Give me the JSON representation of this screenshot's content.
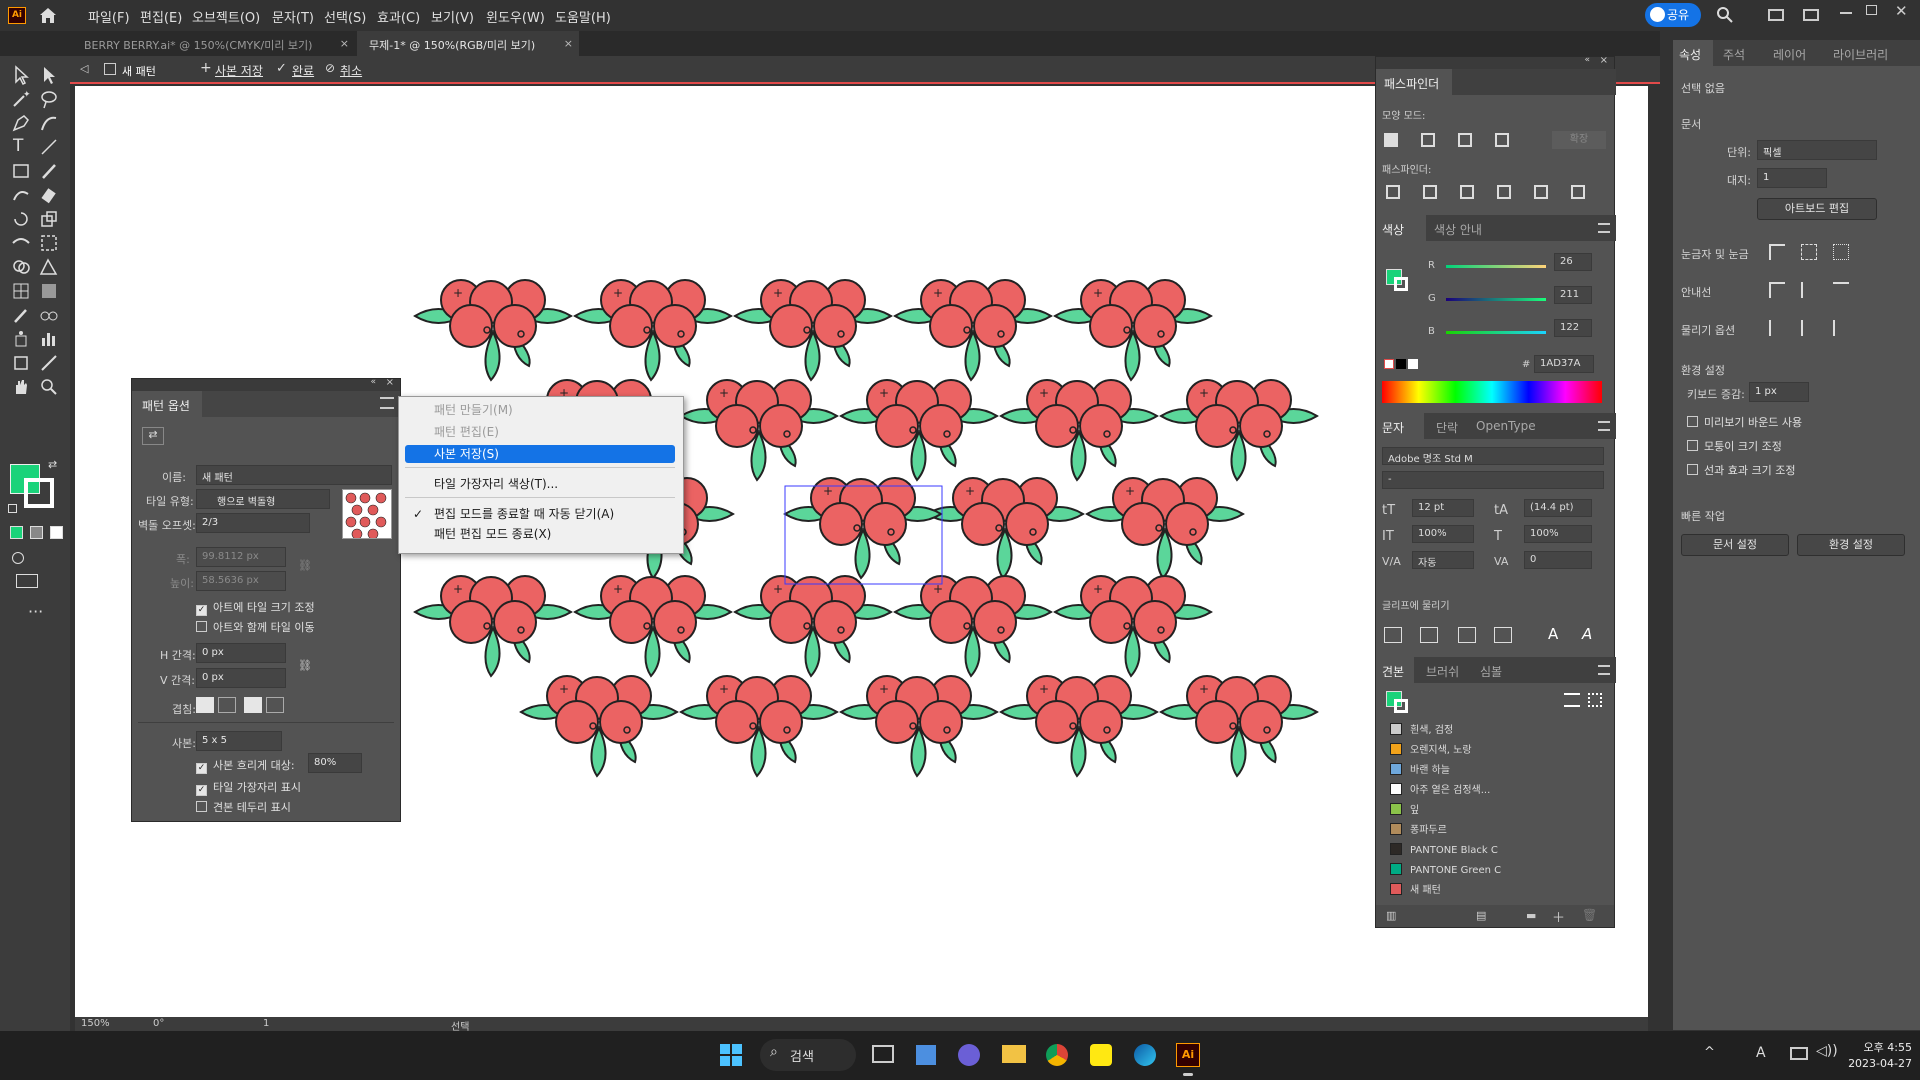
{
  "menubar": {
    "items": [
      "파일(F)",
      "편집(E)",
      "오브젝트(O)",
      "문자(T)",
      "선택(S)",
      "효과(C)",
      "보기(V)",
      "윈도우(W)",
      "도움말(H)"
    ],
    "share": "공유"
  },
  "tabs": [
    {
      "label": "BERRY BERRY.ai* @ 150%(CMYK/미리 보기)"
    },
    {
      "label": "무제-1* @ 150%(RGB/미리 보기)"
    }
  ],
  "isolation": {
    "mode": "새 패턴",
    "save_copy": "사본 저장",
    "done": "완료",
    "cancel": "취소"
  },
  "pattern_panel": {
    "title": "패턴 옵션",
    "name_label": "이름:",
    "name_value": "새 패턴",
    "tile_type_label": "타일 유형:",
    "tile_type_value": "행으로 벽돌형",
    "brick_offset_label": "벽돌 오프셋:",
    "brick_offset_value": "2/3",
    "width_label": "폭:",
    "width_value": "99.8112 px",
    "height_label": "높이:",
    "height_value": "58.5636 px",
    "size_to_art": "아트에 타일 크기 조정",
    "move_with_art": "아트와 함께 타일 이동",
    "h_spacing_label": "H 간격:",
    "h_spacing_value": "0 px",
    "v_spacing_label": "V 간격:",
    "v_spacing_value": "0 px",
    "overlap_label": "겹침:",
    "copies_label": "사본:",
    "copies_value": "5 x 5",
    "dim_copies": "사본 흐리게 대상:",
    "dim_value": "80%",
    "show_tile_edge": "타일 가장자리 표시",
    "show_swatch_bounds": "견본 테두리 표시"
  },
  "flyout": {
    "items": [
      {
        "label": "패턴 만들기(M)",
        "disabled": true
      },
      {
        "label": "패턴 편집(E)",
        "disabled": true
      },
      {
        "label": "사본 저장(S)",
        "highlighted": true
      },
      {
        "label": "타일 가장자리 색상(T)..."
      },
      {
        "label": "편집 모드를 종료할 때 자동 닫기(A)",
        "checked": true
      },
      {
        "label": "패턴 편집 모드 종료(X)"
      }
    ]
  },
  "pathfinder": {
    "title": "패스파인더",
    "shape_modes": "모양 모드:",
    "expand": "확장",
    "pathfinders": "패스파인더:"
  },
  "color": {
    "tab_active": "색상",
    "tab_other": "색상 안내",
    "r_label": "R",
    "r": "26",
    "g_label": "G",
    "g": "211",
    "b_label": "B",
    "b": "122",
    "hash": "#",
    "hex": "1AD37A",
    "fill_color": "#1AD37A"
  },
  "character": {
    "tabs": [
      "문자",
      "단락",
      "OpenType"
    ],
    "font": "Adobe 명조 Std M",
    "style": "-",
    "size": "12 pt",
    "leading": "(14.4 pt)",
    "vscale": "100%",
    "hscale": "100%",
    "kerning": "자동",
    "tracking": "0",
    "snap_label": "글리프에 물리기"
  },
  "swatches": {
    "tabs": [
      "견본",
      "브러쉬",
      "심볼"
    ],
    "items": [
      {
        "label": "흰색, 검정",
        "color": "#cccccc"
      },
      {
        "label": "오렌지색, 노랑",
        "color": "#f2a31b"
      },
      {
        "label": "바랜 하늘",
        "color": "#6fa8dc"
      },
      {
        "label": "아주 옅은 검정색...",
        "color": "#ffffff"
      },
      {
        "label": "잎",
        "color": "#8bc34a"
      },
      {
        "label": "퐁파두르",
        "color": "#b08b5b"
      },
      {
        "label": "PANTONE Black C",
        "color": "#2d2926"
      },
      {
        "label": "PANTONE Green C",
        "color": "#00ab84"
      },
      {
        "label": "새 패턴",
        "color": "#e05a5a"
      }
    ]
  },
  "properties": {
    "tabs": [
      "속성",
      "주석",
      "레이어",
      "라이브러리"
    ],
    "no_selection": "선택 없음",
    "document": "문서",
    "units_label": "단위:",
    "units_value": "픽셀",
    "artboard_label": "대지:",
    "artboard_value": "1",
    "edit_artboard": "아트보드 편집",
    "rulers_grids": "눈금자 및 눈금",
    "guides": "안내선",
    "snap_options": "물리기 옵션",
    "preferences": "환경 설정",
    "keyboard_increment_label": "키보드 증감:",
    "keyboard_increment_value": "1 px",
    "use_preview_bounds": "미리보기 바운드 사용",
    "scale_corners": "모퉁이 크기 조정",
    "scale_strokes": "선과 효과 크기 조정",
    "quick_actions": "빠른 작업",
    "doc_setup": "문서 설정",
    "prefs_btn": "환경 설정"
  },
  "statusbar": {
    "zoom": "150%",
    "angle": "0°",
    "artboard": "1",
    "tool": "선택"
  },
  "taskbar": {
    "search": "검색",
    "time": "오후 4:55",
    "date": "2023-04-27"
  }
}
